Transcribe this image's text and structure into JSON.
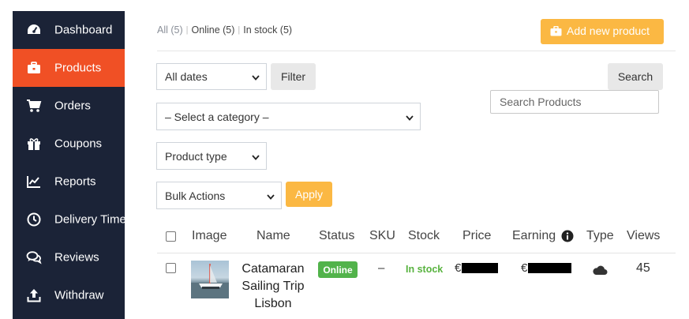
{
  "sidebar": {
    "items": [
      {
        "label": "Dashboard",
        "icon": "dashboard-gauge-icon"
      },
      {
        "label": "Products",
        "icon": "briefcase-icon",
        "active": true
      },
      {
        "label": "Orders",
        "icon": "cart-icon"
      },
      {
        "label": "Coupons",
        "icon": "gift-icon"
      },
      {
        "label": "Reports",
        "icon": "chart-line-icon"
      },
      {
        "label": "Delivery Time",
        "icon": "clock-icon"
      },
      {
        "label": "Reviews",
        "icon": "comments-icon"
      },
      {
        "label": "Withdraw",
        "icon": "upload-icon"
      }
    ]
  },
  "status_tabs": {
    "all": "All (5)",
    "online": "Online (5)",
    "in_stock": "In stock (5)",
    "separator": "|"
  },
  "toolbar": {
    "add_new_product": "Add new product",
    "dates_select": "All dates",
    "filter_button": "Filter",
    "category_select": "– Select a category –",
    "product_type_select": "Product type",
    "bulk_actions_select": "Bulk Actions",
    "apply_button": "Apply",
    "search_button": "Search",
    "search_placeholder": "Search Products"
  },
  "table": {
    "headers": {
      "image": "Image",
      "name": "Name",
      "status": "Status",
      "sku": "SKU",
      "stock": "Stock",
      "price": "Price",
      "earning": "Earning",
      "type": "Type",
      "views": "Views"
    },
    "rows": [
      {
        "name": "Catamaran Sailing Trip Lisbon",
        "status": "Online",
        "sku": "–",
        "stock": "In stock",
        "price_prefix": "€",
        "earning_prefix": "€",
        "type_icon": "cloud-icon",
        "views": "45"
      }
    ]
  },
  "colors": {
    "sidebar_bg": "#1b2337",
    "sidebar_active": "#f05025",
    "accent_button": "#fbb843",
    "online_badge": "#52b34b",
    "in_stock_text": "#58b33f"
  }
}
